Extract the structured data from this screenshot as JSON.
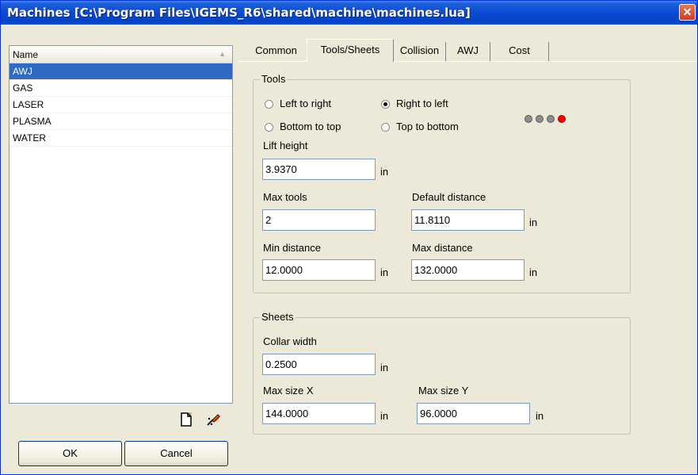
{
  "window": {
    "title": "Machines  [C:\\Program Files\\IGEMS_R6\\shared\\machine\\machines.lua]"
  },
  "list": {
    "header": "Name",
    "items": [
      "AWJ",
      "GAS",
      "LASER",
      "PLASMA",
      "WATER"
    ],
    "selected": "AWJ"
  },
  "buttons": {
    "ok": "OK",
    "cancel": "Cancel"
  },
  "tabs": [
    "Common",
    "Tools/Sheets",
    "Collision",
    "AWJ",
    "Cost"
  ],
  "active_tab": "Tools/Sheets",
  "tools": {
    "group_label": "Tools",
    "radio_left_to_right": "Left to right",
    "radio_right_to_left": "Right to left",
    "radio_bottom_to_top": "Bottom to top",
    "radio_top_to_bottom": "Top to bottom",
    "selected_direction": "Right to left",
    "indicator_lights": [
      "#8c8c8c",
      "#8c8c8c",
      "#8c8c8c",
      "#ff0000"
    ],
    "lift_height_label": "Lift height",
    "lift_height_value": "3.9370",
    "max_tools_label": "Max tools",
    "max_tools_value": "2",
    "default_distance_label": "Default distance",
    "default_distance_value": "11.8110",
    "min_distance_label": "Min distance",
    "min_distance_value": "12.0000",
    "max_distance_label": "Max distance",
    "max_distance_value": "132.0000",
    "unit": "in"
  },
  "sheets": {
    "group_label": "Sheets",
    "collar_width_label": "Collar width",
    "collar_width_value": "0.2500",
    "max_size_x_label": "Max size X",
    "max_size_x_value": "144.0000",
    "max_size_y_label": "Max size Y",
    "max_size_y_value": "96.0000",
    "unit": "in"
  }
}
